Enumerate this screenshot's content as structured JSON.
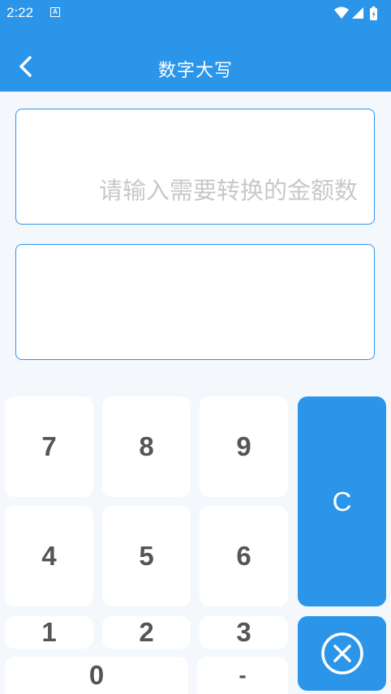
{
  "status_bar": {
    "time": "2:22",
    "notification_icon": "a-square-icon",
    "icons": [
      "wifi-icon",
      "cell-signal-icon",
      "battery-charging-icon"
    ]
  },
  "app_bar": {
    "title": "数字大写",
    "back_icon": "chevron-left-icon"
  },
  "input": {
    "placeholder": "请输入需要转换的金额数",
    "value": ""
  },
  "output": {
    "value": ""
  },
  "keypad": {
    "rows": [
      [
        "7",
        "8",
        "9"
      ],
      [
        "4",
        "5",
        "6"
      ],
      [
        "1",
        "2",
        "3"
      ]
    ],
    "zero": "0",
    "dot": "-",
    "clear": "C",
    "delete_icon": "circle-x-icon"
  },
  "colors": {
    "primary": "#2b95ea",
    "background": "#f4f7fb",
    "key_text": "#555555",
    "placeholder": "#c8c8c8"
  }
}
